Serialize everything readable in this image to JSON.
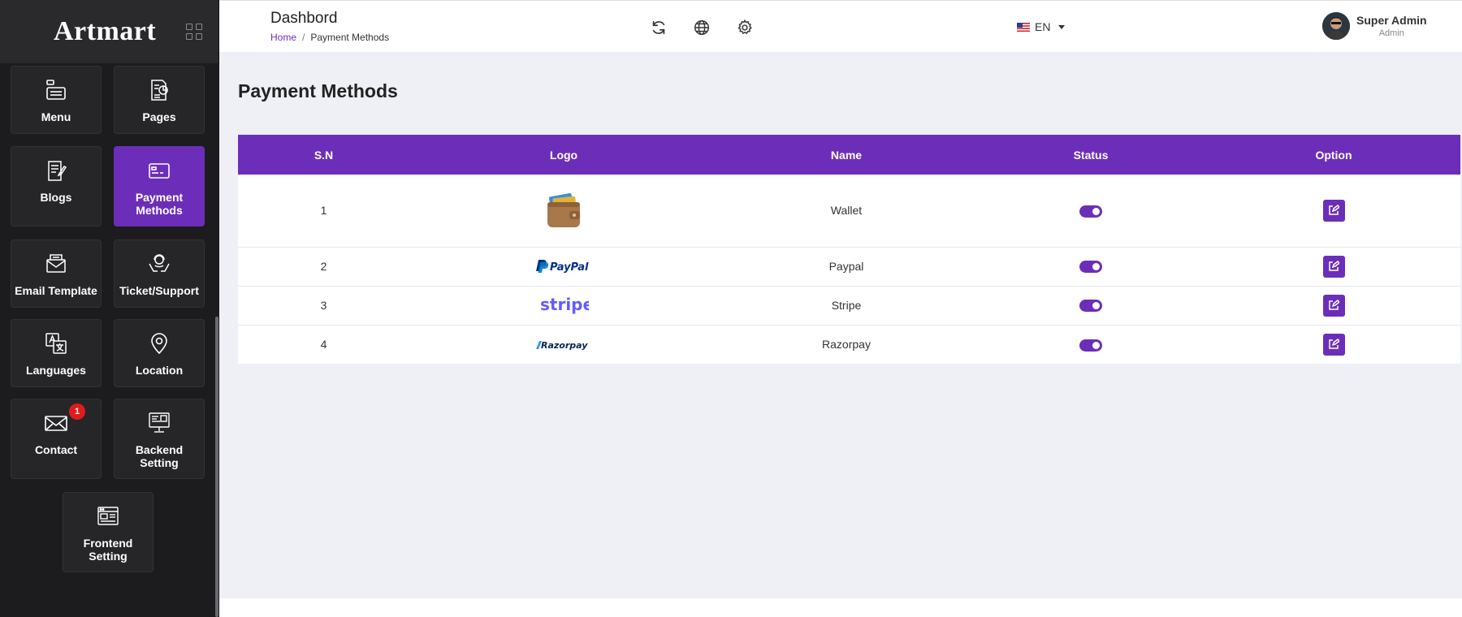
{
  "brand": {
    "name": "Artmart"
  },
  "sidebar": {
    "items": [
      {
        "label": "Menu",
        "icon": "menu-list-icon",
        "active": false
      },
      {
        "label": "Pages",
        "icon": "pages-icon",
        "active": false
      },
      {
        "label": "Blogs",
        "icon": "blogs-icon",
        "active": false
      },
      {
        "label": "Payment Methods",
        "icon": "credit-card-icon",
        "active": true
      },
      {
        "label": "Email Template",
        "icon": "email-template-icon",
        "active": false
      },
      {
        "label": "Ticket/Support",
        "icon": "support-icon",
        "active": false
      },
      {
        "label": "Languages",
        "icon": "translate-icon",
        "active": false
      },
      {
        "label": "Location",
        "icon": "location-pin-icon",
        "active": false
      },
      {
        "label": "Contact",
        "icon": "envelope-icon",
        "active": false,
        "badge": "1"
      },
      {
        "label": "Backend Setting",
        "icon": "backend-monitor-icon",
        "active": false
      },
      {
        "label": "Frontend Setting",
        "icon": "frontend-window-icon",
        "active": false
      }
    ]
  },
  "header": {
    "title": "Dashbord",
    "breadcrumb": {
      "home": "Home",
      "separator": "/",
      "current": "Payment Methods"
    },
    "icons": [
      "refresh-icon",
      "globe-icon",
      "gear-icon"
    ],
    "language": {
      "code": "EN",
      "flag": "us-flag-icon"
    },
    "user": {
      "name": "Super Admin",
      "role": "Admin"
    }
  },
  "main": {
    "title": "Payment Methods",
    "table": {
      "headers": [
        "S.N",
        "Logo",
        "Name",
        "Status",
        "Option"
      ],
      "rows": [
        {
          "sn": "1",
          "logo": "wallet",
          "name": "Wallet",
          "status": true
        },
        {
          "sn": "2",
          "logo": "PayPal",
          "name": "Paypal",
          "status": true
        },
        {
          "sn": "3",
          "logo": "stripe",
          "name": "Stripe",
          "status": true
        },
        {
          "sn": "4",
          "logo": "Razorpay",
          "name": "Razorpay",
          "status": true
        }
      ]
    }
  },
  "colors": {
    "accent": "#6c2eb9",
    "sidebar_bg": "#1c1c1e",
    "tile_bg": "#262628",
    "page_bg": "#eef0f6",
    "badge": "#e01b1b"
  }
}
